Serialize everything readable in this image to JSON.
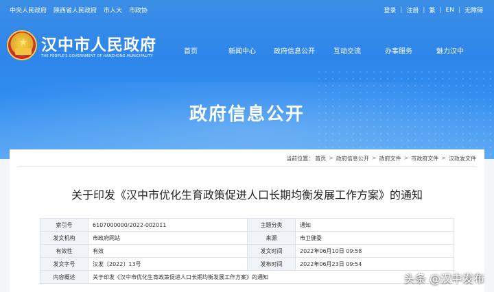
{
  "top_links": [
    "中央人民政府",
    "陕西省人民政府",
    "市人大",
    "市政协"
  ],
  "user_links": {
    "login": "登录",
    "register": "注册",
    "traditional": "繁",
    "english": "EN",
    "accessibility": "无障碍"
  },
  "site": {
    "name": "汉中市人民政府",
    "subtitle": "THE PEOPLE'S GOVERNMENT OF HANZHONG MUNICIPALITY"
  },
  "nav": [
    "首页",
    "新闻中心",
    "政府信息公开",
    "互动交流",
    "办事服务",
    "魅力汉中"
  ],
  "page_heading": "政府信息公开",
  "breadcrumb": {
    "label": "当前位置：",
    "items": [
      "首页",
      "政府信息公开",
      "政府文件",
      "市政府文件",
      "汉政发文件"
    ]
  },
  "doc_title": "关于印发《汉中市优化生育政策促进人口长期均衡发展工作方案》的通知",
  "meta": {
    "rows": [
      {
        "k1": "索引号",
        "v1": "6107000000/2022-002011",
        "k2": "主题分类",
        "v2": "通知"
      },
      {
        "k1": "发文机构",
        "v1": "市政府网站",
        "k2": "来源",
        "v2": "市卫健委"
      },
      {
        "k1": "有效性",
        "v1": "有效",
        "k2": "发文时间",
        "v2": "2022年06月10日 09:58"
      },
      {
        "k1": "发文字号",
        "v1": "汉发〔2022〕13号",
        "k2": "发布时间",
        "v2": "2022年06月23日 09:54"
      }
    ],
    "summary_label": "内容概述",
    "summary_value": "关于印发《汉中市优化生育政策促进人口长期均衡发展工作方案》的通知"
  },
  "watermark": "头条 @汉中发布"
}
